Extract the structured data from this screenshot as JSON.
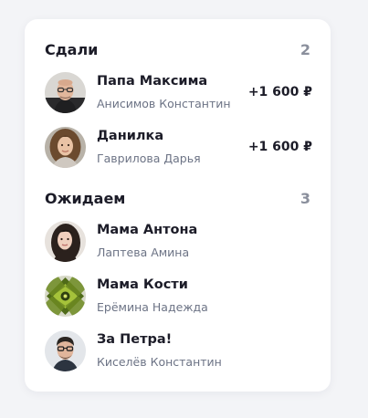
{
  "paid": {
    "title": "Сдали",
    "count": "2",
    "items": [
      {
        "name": "Папа Максима",
        "sub": "Анисимов Константин",
        "amount": "+1 600 ₽",
        "avatar": "man-bald-glasses-photo"
      },
      {
        "name": "Данилка",
        "sub": "Гаврилова Дарья",
        "amount": "+1 600 ₽",
        "avatar": "woman-curly-hair-photo"
      }
    ]
  },
  "waiting": {
    "title": "Ожидаем",
    "count": "3",
    "items": [
      {
        "name": "Мама Антона",
        "sub": "Лаптева Амина",
        "avatar": "woman-dark-hair-photo"
      },
      {
        "name": "Мама Кости",
        "sub": "Ерёмина Надежда",
        "avatar": "green-abstract-pattern"
      },
      {
        "name": "За Петра!",
        "sub": "Киселёв Константин",
        "avatar": "man-glasses-photo"
      }
    ]
  },
  "colors": {
    "background": "#f3f4f7",
    "card": "#ffffff",
    "text_primary": "#1c1c28",
    "text_secondary": "#6c7385",
    "count": "#8a8f9c"
  }
}
